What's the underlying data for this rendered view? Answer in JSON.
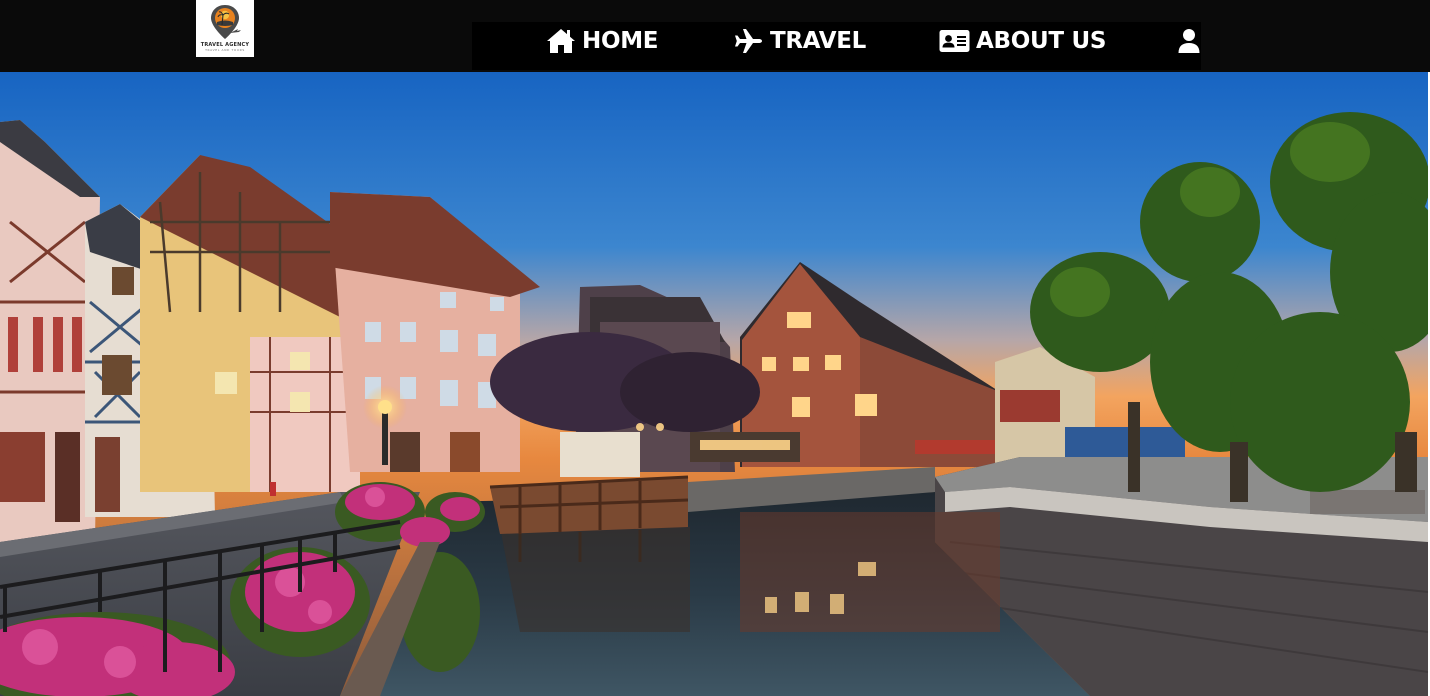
{
  "header": {
    "logo": {
      "text": "TRAVEL AGENCY",
      "tagline": "TRAVEL AND TOURS"
    },
    "nav": [
      {
        "id": "home",
        "label": "HOME",
        "icon": "home-icon"
      },
      {
        "id": "travel",
        "label": "TRAVEL",
        "icon": "airplane-icon"
      },
      {
        "id": "about",
        "label": "ABOUT US",
        "icon": "id-card-icon"
      },
      {
        "id": "user",
        "label": "",
        "icon": "user-icon"
      }
    ]
  },
  "hero": {
    "image": "canal-town-at-dusk"
  },
  "colors": {
    "header_bg": "#0a0a0a",
    "nav_bg": "#000000",
    "nav_text": "#ffffff",
    "logo_accent": "#e8821e"
  }
}
